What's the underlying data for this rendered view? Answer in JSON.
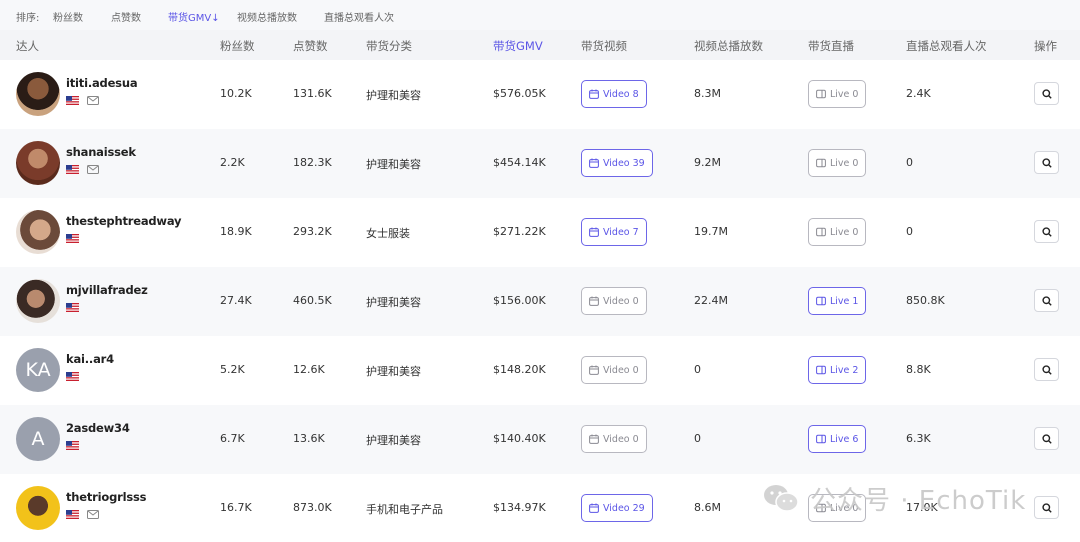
{
  "sort_bar": {
    "label": "排序:",
    "options": [
      "粉丝数",
      "点赞数",
      "带货GMV↓",
      "视频总播放数",
      "直播总观看人次"
    ],
    "active_index": 2
  },
  "table": {
    "columns": [
      "达人",
      "粉丝数",
      "点赞数",
      "带货分类",
      "带货GMV",
      "带货视频",
      "视频总播放数",
      "带货直播",
      "直播总观看人次",
      "操作"
    ],
    "active_column_index": 4,
    "rows": [
      {
        "name": "ititi.adesua",
        "avatar": "photo",
        "initials": "",
        "mail": true,
        "followers": "10.2K",
        "likes": "131.6K",
        "category": "护理和美容",
        "gmv": "$576.05K",
        "video_label": "Video 8",
        "video_count": 8,
        "plays": "8.3M",
        "live_label": "Live 0",
        "live_count": 0,
        "live_views": "2.4K"
      },
      {
        "name": "shanaissek",
        "avatar": "photo",
        "initials": "",
        "mail": true,
        "followers": "2.2K",
        "likes": "182.3K",
        "category": "护理和美容",
        "gmv": "$454.14K",
        "video_label": "Video 39",
        "video_count": 39,
        "plays": "9.2M",
        "live_label": "Live 0",
        "live_count": 0,
        "live_views": "0"
      },
      {
        "name": "thestephtreadway",
        "avatar": "photo",
        "initials": "",
        "mail": false,
        "followers": "18.9K",
        "likes": "293.2K",
        "category": "女士服装",
        "gmv": "$271.22K",
        "video_label": "Video 7",
        "video_count": 7,
        "plays": "19.7M",
        "live_label": "Live 0",
        "live_count": 0,
        "live_views": "0"
      },
      {
        "name": "mjvillafradez",
        "avatar": "photo",
        "initials": "",
        "mail": false,
        "followers": "27.4K",
        "likes": "460.5K",
        "category": "护理和美容",
        "gmv": "$156.00K",
        "video_label": "Video 0",
        "video_count": 0,
        "plays": "22.4M",
        "live_label": "Live 1",
        "live_count": 1,
        "live_views": "850.8K"
      },
      {
        "name": "kai..ar4",
        "avatar": "initials",
        "initials": "KA",
        "mail": false,
        "followers": "5.2K",
        "likes": "12.6K",
        "category": "护理和美容",
        "gmv": "$148.20K",
        "video_label": "Video 0",
        "video_count": 0,
        "plays": "0",
        "live_label": "Live 2",
        "live_count": 2,
        "live_views": "8.8K"
      },
      {
        "name": "2asdew34",
        "avatar": "initials",
        "initials": "A",
        "mail": false,
        "followers": "6.7K",
        "likes": "13.6K",
        "category": "护理和美容",
        "gmv": "$140.40K",
        "video_label": "Video 0",
        "video_count": 0,
        "plays": "0",
        "live_label": "Live 6",
        "live_count": 6,
        "live_views": "6.3K"
      },
      {
        "name": "thetriogrlsss",
        "avatar": "photo",
        "initials": "",
        "mail": true,
        "followers": "16.7K",
        "likes": "873.0K",
        "category": "手机和电子产品",
        "gmv": "$134.97K",
        "video_label": "Video 29",
        "video_count": 29,
        "plays": "8.6M",
        "live_label": "Live 0",
        "live_count": 0,
        "live_views": "17.0K"
      }
    ]
  },
  "watermark": {
    "text": "公众号 · EchoTik"
  },
  "icons": {
    "flag": "us-flag-icon",
    "mail": "mail-icon",
    "video": "video-calendar-icon",
    "live": "live-icon",
    "search": "search-icon",
    "watermark": "wechat-icon"
  },
  "colors": {
    "accent": "#5b55e6",
    "muted_border": "#b8b8c0",
    "row_alt": "#f7f8fa",
    "header_bg": "#f3f4f7"
  }
}
